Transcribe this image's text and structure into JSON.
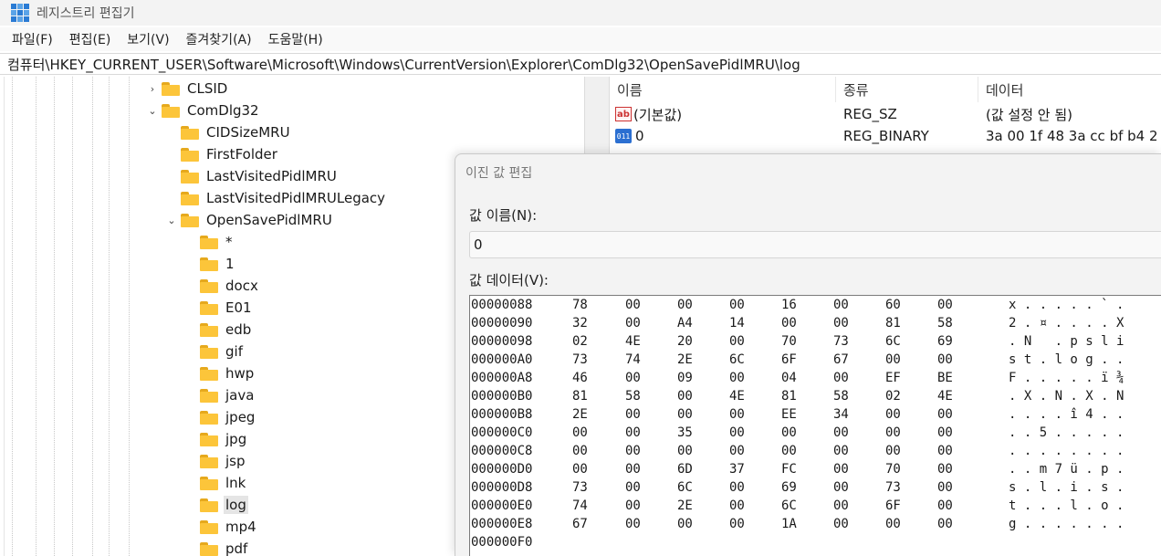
{
  "window": {
    "title": "레지스트리 편집기",
    "app_icon": "registry-editor-icon"
  },
  "menu": [
    "파일(F)",
    "편집(E)",
    "보기(V)",
    "즐겨찾기(A)",
    "도움말(H)"
  ],
  "address": "컴퓨터\\HKEY_CURRENT_USER\\Software\\Microsoft\\Windows\\CurrentVersion\\Explorer\\ComDlg32\\OpenSavePidlMRU\\log",
  "tree": [
    {
      "label": "CLSID",
      "level": 0,
      "expander": "collapsed"
    },
    {
      "label": "ComDlg32",
      "level": 0,
      "expander": "expanded"
    },
    {
      "label": "CIDSizeMRU",
      "level": 1,
      "expander": "none"
    },
    {
      "label": "FirstFolder",
      "level": 1,
      "expander": "none"
    },
    {
      "label": "LastVisitedPidlMRU",
      "level": 1,
      "expander": "none"
    },
    {
      "label": "LastVisitedPidlMRULegacy",
      "level": 1,
      "expander": "none"
    },
    {
      "label": "OpenSavePidlMRU",
      "level": 1,
      "expander": "expanded"
    },
    {
      "label": "*",
      "level": 2,
      "expander": "none"
    },
    {
      "label": "1",
      "level": 2,
      "expander": "none"
    },
    {
      "label": "docx",
      "level": 2,
      "expander": "none"
    },
    {
      "label": "E01",
      "level": 2,
      "expander": "none"
    },
    {
      "label": "edb",
      "level": 2,
      "expander": "none"
    },
    {
      "label": "gif",
      "level": 2,
      "expander": "none"
    },
    {
      "label": "hwp",
      "level": 2,
      "expander": "none"
    },
    {
      "label": "java",
      "level": 2,
      "expander": "none"
    },
    {
      "label": "jpeg",
      "level": 2,
      "expander": "none"
    },
    {
      "label": "jpg",
      "level": 2,
      "expander": "none"
    },
    {
      "label": "jsp",
      "level": 2,
      "expander": "none"
    },
    {
      "label": "lnk",
      "level": 2,
      "expander": "none"
    },
    {
      "label": "log",
      "level": 2,
      "expander": "none",
      "selected": true
    },
    {
      "label": "mp4",
      "level": 2,
      "expander": "none"
    },
    {
      "label": "pdf",
      "level": 2,
      "expander": "none"
    }
  ],
  "list": {
    "columns": [
      "이름",
      "종류",
      "데이터"
    ],
    "rows": [
      {
        "icon": "string-value-icon",
        "icon_text": "ab",
        "name": "(기본값)",
        "type": "REG_SZ",
        "data": "(값 설정 안 됨)"
      },
      {
        "icon": "binary-value-icon",
        "icon_text": "011",
        "name": "0",
        "type": "REG_BINARY",
        "data": "3a 00 1f 48 3a cc bf b4 2"
      }
    ]
  },
  "dialog": {
    "title": "이진 값 편집",
    "name_label": "값 이름(N):",
    "name_value": "0",
    "data_label": "값 데이터(V):",
    "hex_rows": [
      {
        "addr": "00000088",
        "bytes": [
          "78",
          "00",
          "00",
          "00",
          "16",
          "00",
          "60",
          "00"
        ],
        "ascii": "x . . . . . ` ."
      },
      {
        "addr": "00000090",
        "bytes": [
          "32",
          "00",
          "A4",
          "14",
          "00",
          "00",
          "81",
          "58"
        ],
        "ascii": "2 . ¤ . . . . X"
      },
      {
        "addr": "00000098",
        "bytes": [
          "02",
          "4E",
          "20",
          "00",
          "70",
          "73",
          "6C",
          "69"
        ],
        "ascii": ". N   . p s l i"
      },
      {
        "addr": "000000A0",
        "bytes": [
          "73",
          "74",
          "2E",
          "6C",
          "6F",
          "67",
          "00",
          "00"
        ],
        "ascii": "s t . l o g . ."
      },
      {
        "addr": "000000A8",
        "bytes": [
          "46",
          "00",
          "09",
          "00",
          "04",
          "00",
          "EF",
          "BE"
        ],
        "ascii": "F . . . . . ï ¾"
      },
      {
        "addr": "000000B0",
        "bytes": [
          "81",
          "58",
          "00",
          "4E",
          "81",
          "58",
          "02",
          "4E"
        ],
        "ascii": ". X . N . X . N"
      },
      {
        "addr": "000000B8",
        "bytes": [
          "2E",
          "00",
          "00",
          "00",
          "EE",
          "34",
          "00",
          "00"
        ],
        "ascii": ". . . . î 4 . ."
      },
      {
        "addr": "000000C0",
        "bytes": [
          "00",
          "00",
          "35",
          "00",
          "00",
          "00",
          "00",
          "00"
        ],
        "ascii": ". . 5 . . . . ."
      },
      {
        "addr": "000000C8",
        "bytes": [
          "00",
          "00",
          "00",
          "00",
          "00",
          "00",
          "00",
          "00"
        ],
        "ascii": ". . . . . . . ."
      },
      {
        "addr": "000000D0",
        "bytes": [
          "00",
          "00",
          "6D",
          "37",
          "FC",
          "00",
          "70",
          "00"
        ],
        "ascii": ". . m 7 ü . p ."
      },
      {
        "addr": "000000D8",
        "bytes": [
          "73",
          "00",
          "6C",
          "00",
          "69",
          "00",
          "73",
          "00"
        ],
        "ascii": "s . l . i . s ."
      },
      {
        "addr": "000000E0",
        "bytes": [
          "74",
          "00",
          "2E",
          "00",
          "6C",
          "00",
          "6F",
          "00"
        ],
        "ascii": "t . . . l . o ."
      },
      {
        "addr": "000000E8",
        "bytes": [
          "67",
          "00",
          "00",
          "00",
          "1A",
          "00",
          "00",
          "00"
        ],
        "ascii": "g . . . . . . ."
      },
      {
        "addr": "000000F0",
        "bytes": [],
        "ascii": ""
      }
    ]
  }
}
